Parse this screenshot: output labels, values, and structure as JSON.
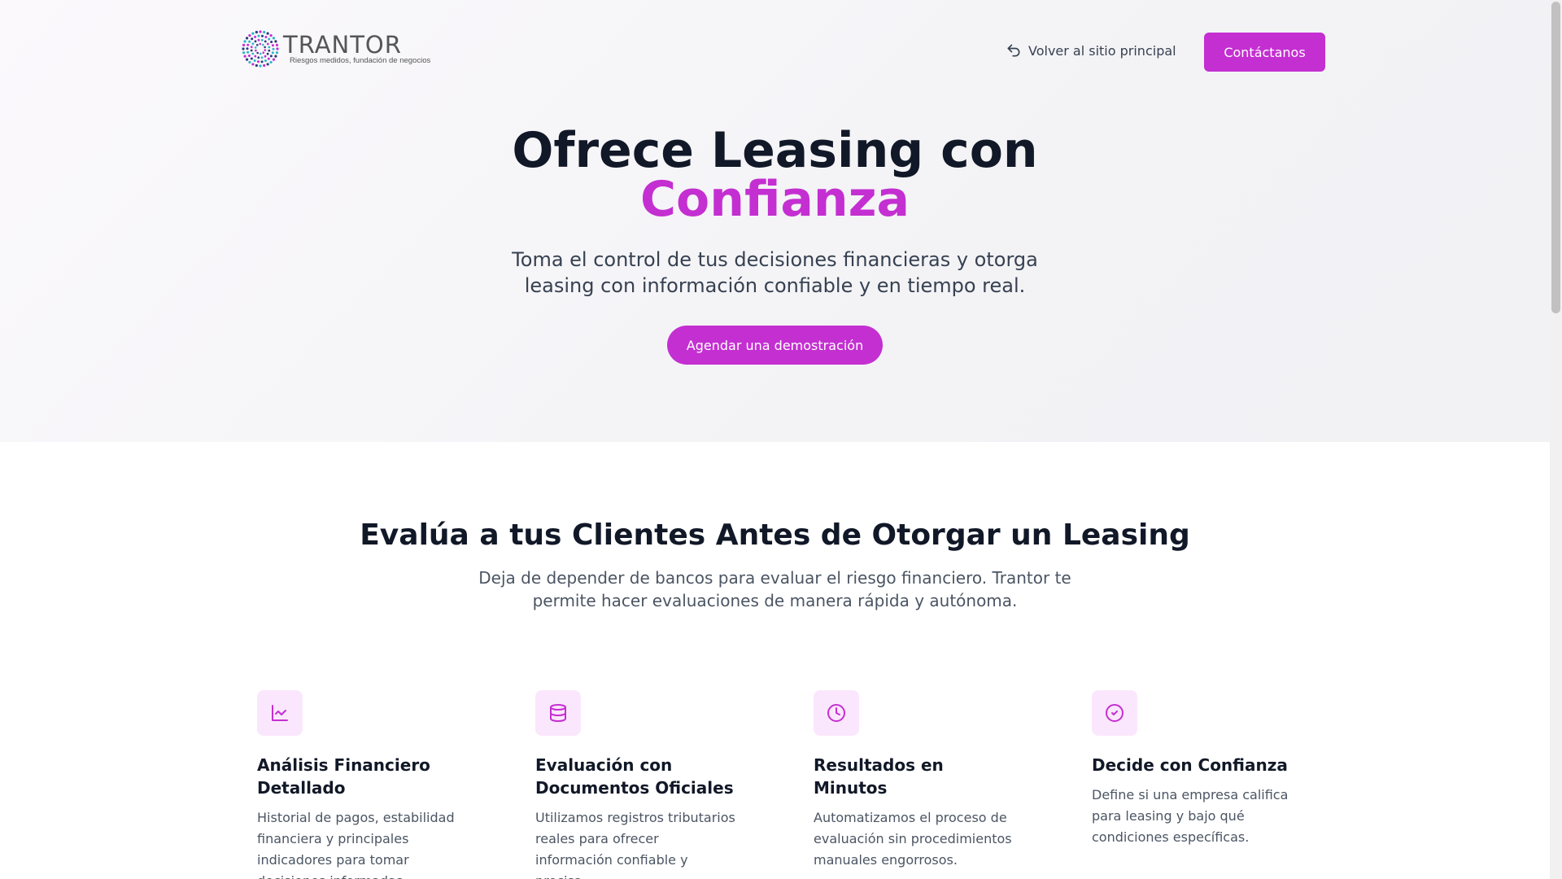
{
  "brand": {
    "name": "TRANTOR",
    "tagline": "Riesgos medidos, fundación de negocios",
    "logo_colors": [
      "#c42fd1",
      "#2bb6c6",
      "#2a3a7a"
    ]
  },
  "nav": {
    "back_label": "Volver al sitio principal",
    "contact_label": "Contáctanos"
  },
  "hero": {
    "title_line1": "Ofrece Leasing con",
    "title_line2": "Confianza",
    "subtitle": "Toma el control de tus decisiones financieras y otorga leasing con información confiable y en tiempo real.",
    "cta_label": "Agendar una demostración"
  },
  "section": {
    "title": "Evalúa a tus Clientes Antes de Otorgar un Leasing",
    "subtitle": "Deja de depender de bancos para evaluar el riesgo financiero. Trantor te permite hacer evaluaciones de manera rápida y autónoma."
  },
  "features": [
    {
      "icon": "chart-line-icon",
      "title": "Análisis Financiero Detallado",
      "text": "Historial de pagos, estabilidad financiera y principales indicadores para tomar decisiones informadas."
    },
    {
      "icon": "database-icon",
      "title": "Evaluación con Documentos Oficiales",
      "text": "Utilizamos registros tributarios reales para ofrecer información confiable y precisa."
    },
    {
      "icon": "clock-icon",
      "title": "Resultados en Minutos",
      "text": "Automatizamos el proceso de evaluación sin procedimientos manuales engorrosos."
    },
    {
      "icon": "check-circle-icon",
      "title": "Decide con Confianza",
      "text": "Define si una empresa califica para leasing y bajo qué condiciones específicas."
    }
  ],
  "colors": {
    "accent": "#c42fd1",
    "icon_bg": "#fbe7fd",
    "text_dark": "#111827",
    "text_muted": "#4b5563"
  }
}
